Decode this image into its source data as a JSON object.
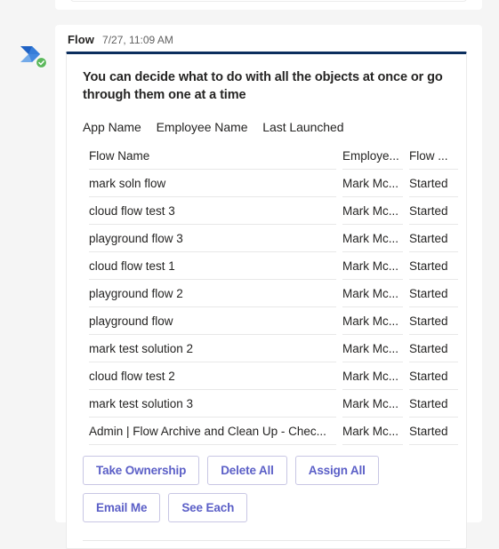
{
  "message": {
    "sender": "Flow",
    "timestamp": "7/27, 11:09 AM",
    "avatar_icon": "power-automate-logo",
    "status_icon": "verified-check-icon"
  },
  "card": {
    "accent_color": "#0b2e5e",
    "prompt": "You can decide what to do with all the objects at once or go through them one at a time",
    "subline": {
      "label_1": "App Name",
      "label_2": "Employee Name",
      "label_3": "Last Launched"
    },
    "table": {
      "columns": [
        "Flow Name",
        "Employe...",
        "Flow ..."
      ],
      "rows": [
        {
          "name": "mark soln flow",
          "employee": "Mark Mc...",
          "state": "Started"
        },
        {
          "name": "cloud flow test 3",
          "employee": "Mark Mc...",
          "state": "Started"
        },
        {
          "name": "playground flow 3",
          "employee": "Mark Mc...",
          "state": "Started"
        },
        {
          "name": "cloud flow test 1",
          "employee": "Mark Mc...",
          "state": "Started"
        },
        {
          "name": "playground flow 2",
          "employee": "Mark Mc...",
          "state": "Started"
        },
        {
          "name": "playground flow",
          "employee": "Mark Mc...",
          "state": "Started"
        },
        {
          "name": "mark test solution 2",
          "employee": "Mark Mc...",
          "state": "Started"
        },
        {
          "name": "cloud flow test 2",
          "employee": "Mark Mc...",
          "state": "Started"
        },
        {
          "name": "mark test solution 3",
          "employee": "Mark Mc...",
          "state": "Started"
        },
        {
          "name": "Admin | Flow Archive and Clean Up - Chec...",
          "employee": "Mark Mc...",
          "state": "Started"
        }
      ]
    },
    "actions": {
      "button_color": "#5b5fc7",
      "row_1": [
        "Take Ownership",
        "Delete All",
        "Assign All"
      ],
      "row_2": [
        "Email Me",
        "See Each"
      ]
    }
  }
}
